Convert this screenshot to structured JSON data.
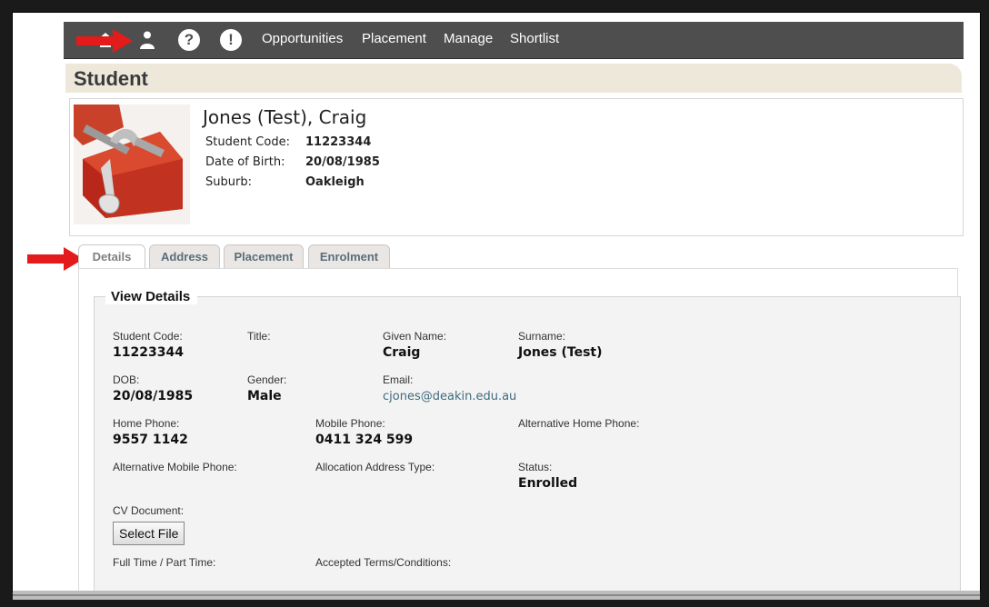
{
  "nav": {
    "icons": [
      "home-icon",
      "user-icon",
      "help-icon",
      "alert-icon"
    ],
    "help_glyph": "?",
    "alert_glyph": "!",
    "links": [
      "Opportunities",
      "Placement",
      "Manage",
      "Shortlist"
    ]
  },
  "page": {
    "title": "Student"
  },
  "student": {
    "name": "Jones (Test), Craig",
    "fields": [
      {
        "label": "Student Code:",
        "value": "11223344"
      },
      {
        "label": "Date of Birth:",
        "value": "20/08/1985"
      },
      {
        "label": "Suburb:",
        "value": "Oakleigh"
      }
    ]
  },
  "tabs": [
    {
      "label": "Details",
      "active": true
    },
    {
      "label": "Address",
      "active": false
    },
    {
      "label": "Placement",
      "active": false
    },
    {
      "label": "Enrolment",
      "active": false
    }
  ],
  "details": {
    "legend": "View Details",
    "fields": {
      "student_code": {
        "label": "Student Code:",
        "value": "11223344"
      },
      "title": {
        "label": "Title:",
        "value": ""
      },
      "given_name": {
        "label": "Given Name:",
        "value": "Craig"
      },
      "surname": {
        "label": "Surname:",
        "value": "Jones (Test)"
      },
      "dob": {
        "label": "DOB:",
        "value": "20/08/1985"
      },
      "gender": {
        "label": "Gender:",
        "value": "Male"
      },
      "email": {
        "label": "Email:",
        "value": "cjones@deakin.edu.au"
      },
      "home_phone": {
        "label": "Home Phone:",
        "value": "9557 1142"
      },
      "mobile_phone": {
        "label": "Mobile Phone:",
        "value": "0411 324 599"
      },
      "alt_home_phone": {
        "label": "Alternative Home Phone:",
        "value": ""
      },
      "alt_mobile_phone": {
        "label": "Alternative Mobile Phone:",
        "value": ""
      },
      "allocation_address_type": {
        "label": "Allocation Address Type:",
        "value": ""
      },
      "status": {
        "label": "Status:",
        "value": "Enrolled"
      },
      "cv_document": {
        "label": "CV Document:",
        "button": "Select File"
      },
      "full_part_time": {
        "label": "Full Time / Part Time:"
      },
      "accepted_terms": {
        "label": "Accepted Terms/Conditions:"
      }
    }
  },
  "colors": {
    "nav_bg": "#4e4e4e",
    "arrow": "#e31b1b",
    "title_bg": "#ede8da",
    "tab_text": "#5a6e7a"
  }
}
